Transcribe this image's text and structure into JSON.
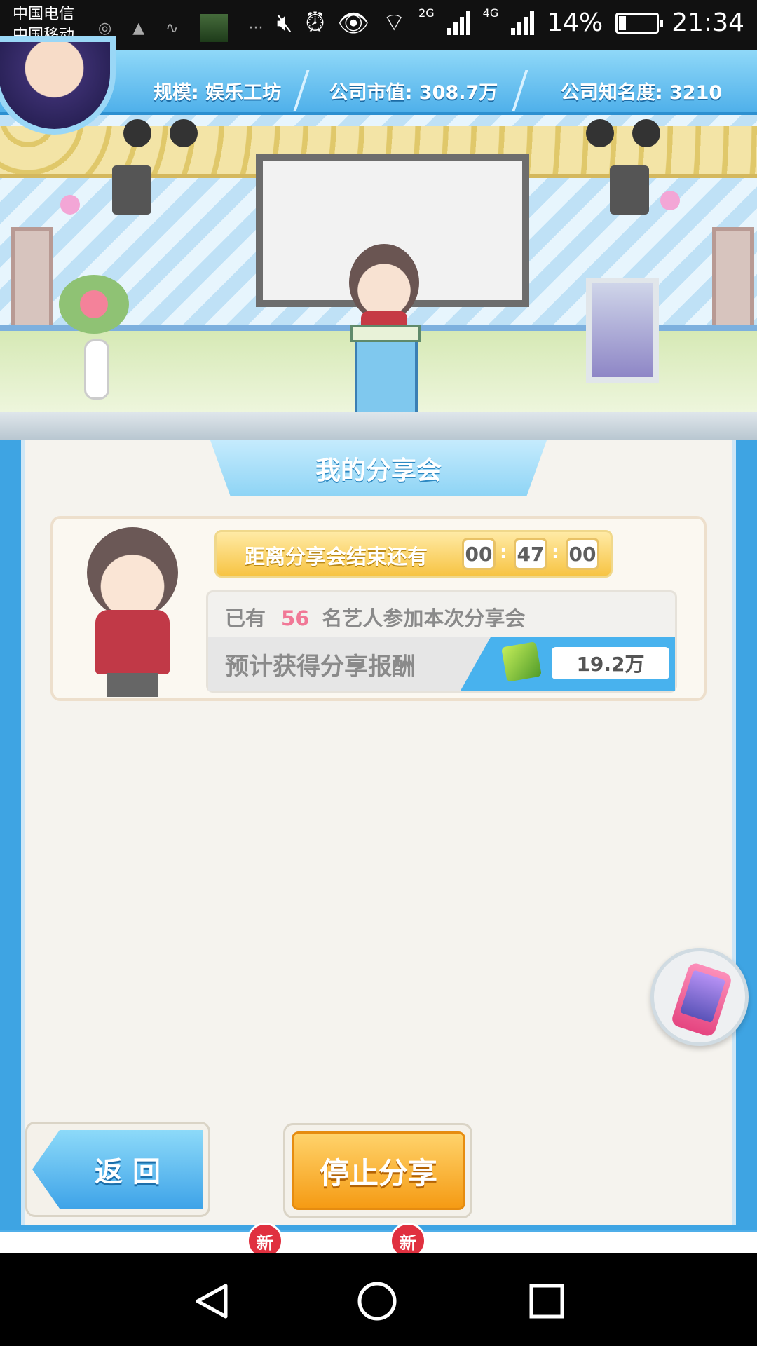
{
  "status_bar": {
    "carrier1": "中国电信",
    "carrier2": "中国移动",
    "net_2g": "2G",
    "net_4g": "4G",
    "battery_percent": "14%",
    "time": "21:34",
    "overflow": "···"
  },
  "info_bar": {
    "scale": "规模: 娱乐工坊",
    "market_value": "公司市值: 308.7万",
    "fame": "公司知名度: 3210"
  },
  "panel": {
    "title": "我的分享会",
    "timer_label": "距离分享会结束还有",
    "timer": {
      "hours": "00",
      "minutes": "47",
      "seconds": "00",
      "sep": ":"
    },
    "participants_prefix": "已有",
    "participants_count": "56",
    "participants_suffix": "名艺人参加本次分享会",
    "reward_label": "预计获得分享报酬",
    "reward_value": "19.2万"
  },
  "buttons": {
    "back": "返 回",
    "stop": "停止分享"
  },
  "bottom_tabs": {
    "badge1": "新",
    "badge2": "新"
  },
  "colors": {
    "accent_blue": "#3ea4e3",
    "stop_orange": "#f59b14",
    "participants_pink": "#f17896"
  }
}
